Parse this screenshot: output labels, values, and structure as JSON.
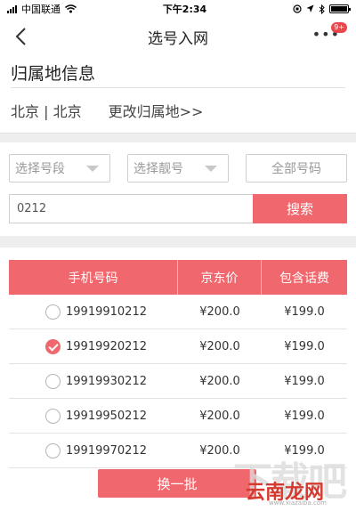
{
  "status_bar": {
    "carrier": "中国联通",
    "time": "下午2:34"
  },
  "nav": {
    "title": "选号入网",
    "badge": "9+"
  },
  "location": {
    "title": "归属地信息",
    "current": "北京 | 北京",
    "change_link": "更改归属地>>"
  },
  "filters": {
    "segment_placeholder": "选择号段",
    "pretty_placeholder": "选择靓号",
    "all_numbers": "全部号码"
  },
  "search": {
    "value": "0212",
    "button": "搜索"
  },
  "table": {
    "headers": {
      "phone": "手机号码",
      "price": "京东价",
      "fee": "包含话费"
    },
    "rows": [
      {
        "phone": "19919910212",
        "price": "¥200.0",
        "fee": "¥199.0",
        "selected": false
      },
      {
        "phone": "19919920212",
        "price": "¥200.0",
        "fee": "¥199.0",
        "selected": true
      },
      {
        "phone": "19919930212",
        "price": "¥200.0",
        "fee": "¥199.0",
        "selected": false
      },
      {
        "phone": "19919950212",
        "price": "¥200.0",
        "fee": "¥199.0",
        "selected": false
      },
      {
        "phone": "19919970212",
        "price": "¥200.0",
        "fee": "¥199.0",
        "selected": false
      }
    ]
  },
  "refresh_button": "换一批",
  "watermark": {
    "big": "下载吧",
    "brand": "云南龙网",
    "url": "www.xiazaiba.com"
  },
  "colors": {
    "accent": "#f0676d",
    "badge": "#e8484c"
  },
  "icons": {
    "back": "chevron-left-icon",
    "more": "more-dots-icon",
    "wifi": "wifi-icon",
    "battery": "battery-icon"
  }
}
